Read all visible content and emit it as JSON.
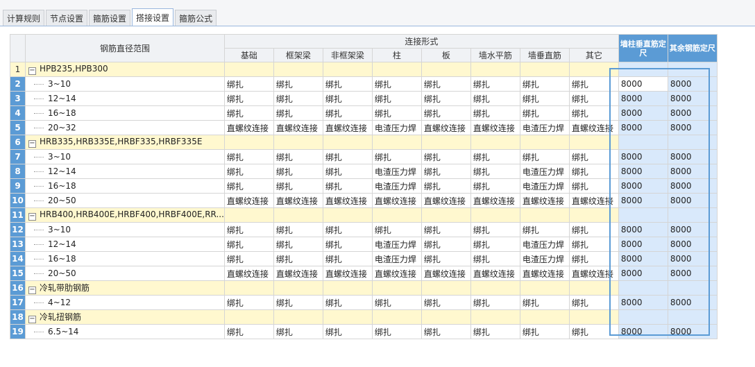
{
  "tabs": [
    {
      "label": "计算规则",
      "active": false
    },
    {
      "label": "节点设置",
      "active": false
    },
    {
      "label": "箍筋设置",
      "active": false
    },
    {
      "label": "搭接设置",
      "active": true
    },
    {
      "label": "箍筋公式",
      "active": false
    }
  ],
  "header": {
    "range_col": "钢筋直径范围",
    "group": "连接形式",
    "cols": [
      "基础",
      "框架梁",
      "非框架梁",
      "柱",
      "板",
      "墙水平筋",
      "墙垂直筋",
      "其它"
    ],
    "wall_col": "墙柱垂直筋定尺",
    "other_col": "其余钢筋定尺"
  },
  "rows": [
    {
      "n": "1",
      "group": true,
      "name": "HPB235,HPB300",
      "toggle": "−"
    },
    {
      "n": "2",
      "name": "3~10",
      "v": [
        "绑扎",
        "绑扎",
        "绑扎",
        "绑扎",
        "绑扎",
        "绑扎",
        "绑扎",
        "绑扎"
      ],
      "w": "8000",
      "o": "8000"
    },
    {
      "n": "3",
      "name": "12~14",
      "v": [
        "绑扎",
        "绑扎",
        "绑扎",
        "绑扎",
        "绑扎",
        "绑扎",
        "绑扎",
        "绑扎"
      ],
      "w": "8000",
      "o": "8000"
    },
    {
      "n": "4",
      "name": "16~18",
      "v": [
        "绑扎",
        "绑扎",
        "绑扎",
        "绑扎",
        "绑扎",
        "绑扎",
        "绑扎",
        "绑扎"
      ],
      "w": "8000",
      "o": "8000"
    },
    {
      "n": "5",
      "name": "20~32",
      "v": [
        "直螺纹连接",
        "直螺纹连接",
        "直螺纹连接",
        "电渣压力焊",
        "直螺纹连接",
        "直螺纹连接",
        "电渣压力焊",
        "直螺纹连接"
      ],
      "w": "8000",
      "o": "8000"
    },
    {
      "n": "6",
      "group": true,
      "name": "HRB335,HRB335E,HRBF335,HRBF335E",
      "toggle": "−"
    },
    {
      "n": "7",
      "name": "3~10",
      "v": [
        "绑扎",
        "绑扎",
        "绑扎",
        "绑扎",
        "绑扎",
        "绑扎",
        "绑扎",
        "绑扎"
      ],
      "w": "8000",
      "o": "8000"
    },
    {
      "n": "8",
      "name": "12~14",
      "v": [
        "绑扎",
        "绑扎",
        "绑扎",
        "电渣压力焊",
        "绑扎",
        "绑扎",
        "电渣压力焊",
        "绑扎"
      ],
      "w": "8000",
      "o": "8000"
    },
    {
      "n": "9",
      "name": "16~18",
      "v": [
        "绑扎",
        "绑扎",
        "绑扎",
        "电渣压力焊",
        "绑扎",
        "绑扎",
        "电渣压力焊",
        "绑扎"
      ],
      "w": "8000",
      "o": "8000"
    },
    {
      "n": "10",
      "name": "20~50",
      "v": [
        "直螺纹连接",
        "直螺纹连接",
        "直螺纹连接",
        "直螺纹连接",
        "直螺纹连接",
        "直螺纹连接",
        "直螺纹连接",
        "直螺纹连接"
      ],
      "w": "8000",
      "o": "8000"
    },
    {
      "n": "11",
      "group": true,
      "name": "HRB400,HRB400E,HRBF400,HRBF400E,RR...",
      "toggle": "−"
    },
    {
      "n": "12",
      "name": "3~10",
      "v": [
        "绑扎",
        "绑扎",
        "绑扎",
        "绑扎",
        "绑扎",
        "绑扎",
        "绑扎",
        "绑扎"
      ],
      "w": "8000",
      "o": "8000"
    },
    {
      "n": "13",
      "name": "12~14",
      "v": [
        "绑扎",
        "绑扎",
        "绑扎",
        "电渣压力焊",
        "绑扎",
        "绑扎",
        "电渣压力焊",
        "绑扎"
      ],
      "w": "8000",
      "o": "8000"
    },
    {
      "n": "14",
      "name": "16~18",
      "v": [
        "绑扎",
        "绑扎",
        "绑扎",
        "电渣压力焊",
        "绑扎",
        "绑扎",
        "电渣压力焊",
        "绑扎"
      ],
      "w": "8000",
      "o": "8000"
    },
    {
      "n": "15",
      "name": "20~50",
      "v": [
        "直螺纹连接",
        "直螺纹连接",
        "直螺纹连接",
        "直螺纹连接",
        "直螺纹连接",
        "直螺纹连接",
        "直螺纹连接",
        "直螺纹连接"
      ],
      "w": "8000",
      "o": "8000"
    },
    {
      "n": "16",
      "group": true,
      "name": "冷轧带肋钢筋",
      "toggle": "−"
    },
    {
      "n": "17",
      "name": "4~12",
      "v": [
        "绑扎",
        "绑扎",
        "绑扎",
        "绑扎",
        "绑扎",
        "绑扎",
        "绑扎",
        "绑扎"
      ],
      "w": "8000",
      "o": "8000"
    },
    {
      "n": "18",
      "group": true,
      "name": "冷轧扭钢筋",
      "toggle": "−"
    },
    {
      "n": "19",
      "name": "6.5~14",
      "v": [
        "绑扎",
        "绑扎",
        "绑扎",
        "绑扎",
        "绑扎",
        "绑扎",
        "绑扎",
        "绑扎"
      ],
      "w": "8000",
      "o": "8000"
    }
  ],
  "colors": {
    "selection": "#5b9bd5",
    "selected_fill": "#d9e9fb",
    "group_fill": "#fff8cf"
  }
}
